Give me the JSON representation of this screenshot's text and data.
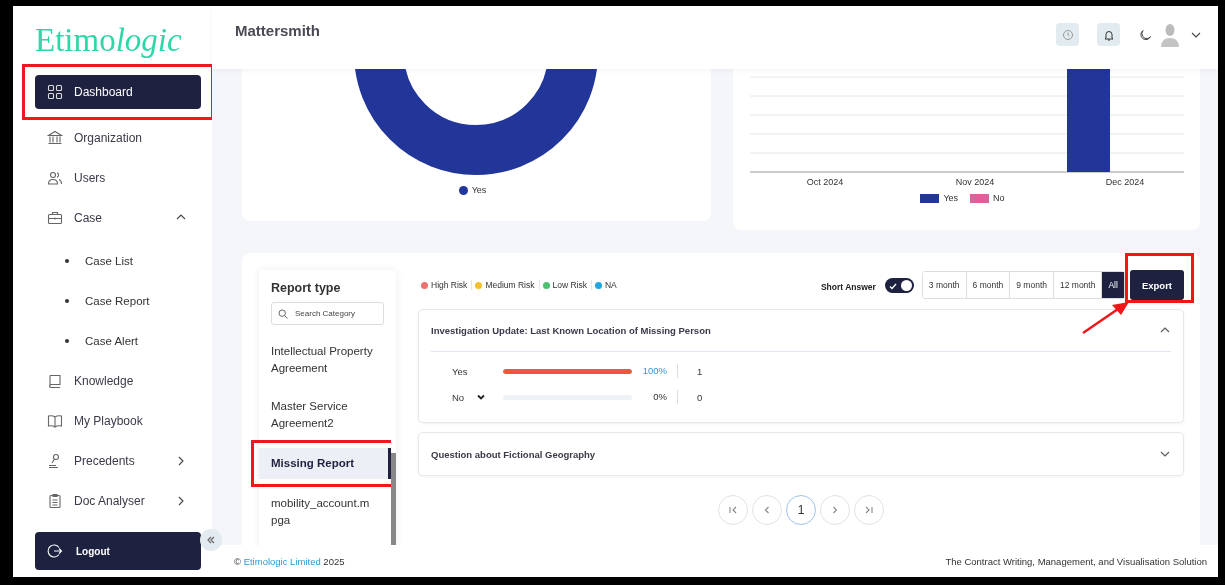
{
  "sidebar": {
    "logo": {
      "upright": "Etimo",
      "italic": "logic"
    },
    "nav_items": [
      {
        "label": "Dashboard",
        "selected": true,
        "highlighted": true
      },
      {
        "label": "Organization",
        "selected": false
      },
      {
        "label": "Users",
        "selected": false
      },
      {
        "label": "Case",
        "selected": false,
        "expanded": true,
        "children": [
          {
            "label": "Case List"
          },
          {
            "label": "Case Report"
          },
          {
            "label": "Case Alert"
          }
        ]
      },
      {
        "label": "Knowledge",
        "selected": false
      },
      {
        "label": "My Playbook",
        "selected": false
      },
      {
        "label": "Precedents",
        "selected": false,
        "expanded": false
      },
      {
        "label": "Doc Analyser",
        "selected": false,
        "expanded": false
      }
    ],
    "logout": "Logout"
  },
  "header": {
    "title": "Mattersmith"
  },
  "donut_chart": {
    "legend": [
      {
        "label": "Yes",
        "color": "#22369a"
      }
    ]
  },
  "bar_chart": {
    "x_labels": [
      "Oct 2024",
      "Nov 2024",
      "Dec 2024"
    ],
    "legend": [
      {
        "label": "Yes",
        "color": "#22369a"
      },
      {
        "label": "No",
        "color": "#e0619a"
      }
    ]
  },
  "report_panel": {
    "title": "Report type",
    "search": {
      "placeholder": "Search Category"
    },
    "categories": [
      {
        "label": "Intellectual Property Agreement",
        "selected": false,
        "highlighted": false
      },
      {
        "label": "Master Service Agreement2",
        "selected": false,
        "highlighted": false
      },
      {
        "label": "Missing Report",
        "selected": true,
        "highlighted": true
      },
      {
        "label": "mobility_account.mpga",
        "selected": false,
        "highlighted": false
      }
    ]
  },
  "risk_legend": [
    {
      "label": "High Risk",
      "color": "#f07070"
    },
    {
      "label": "Medium Risk",
      "color": "#f5c02c"
    },
    {
      "label": "Low Risk",
      "color": "#4cbf72"
    },
    {
      "label": "NA",
      "color": "#1ea7e1"
    }
  ],
  "short_answer": {
    "label": "Short Answer",
    "on": true
  },
  "periods": [
    {
      "label": "3 month",
      "selected": false
    },
    {
      "label": "6 month",
      "selected": false
    },
    {
      "label": "9 month",
      "selected": false
    },
    {
      "label": "12 month",
      "selected": false
    },
    {
      "label": "All",
      "selected": true
    }
  ],
  "export": {
    "label": "Export",
    "highlighted": true,
    "pointed": true
  },
  "questions": [
    {
      "title": "Investigation Update: Last Known Location of Missing Person",
      "expanded": true,
      "answers": [
        {
          "label": "Yes",
          "expandable": false,
          "level": 1,
          "percent": "100%",
          "count": "1"
        },
        {
          "label": "No",
          "expandable": true,
          "level": 0,
          "percent": "0%",
          "count": "0"
        }
      ]
    },
    {
      "title": "Question about Fictional Geography",
      "expanded": false
    }
  ],
  "pagination": {
    "pages": [
      {
        "label": "1",
        "selected": true
      }
    ]
  },
  "footer": {
    "symbol": "©",
    "link": "Etimologic Limited",
    "year": "2025",
    "tagline": "The Contract Writing, Management, and Visualisation Solution"
  }
}
